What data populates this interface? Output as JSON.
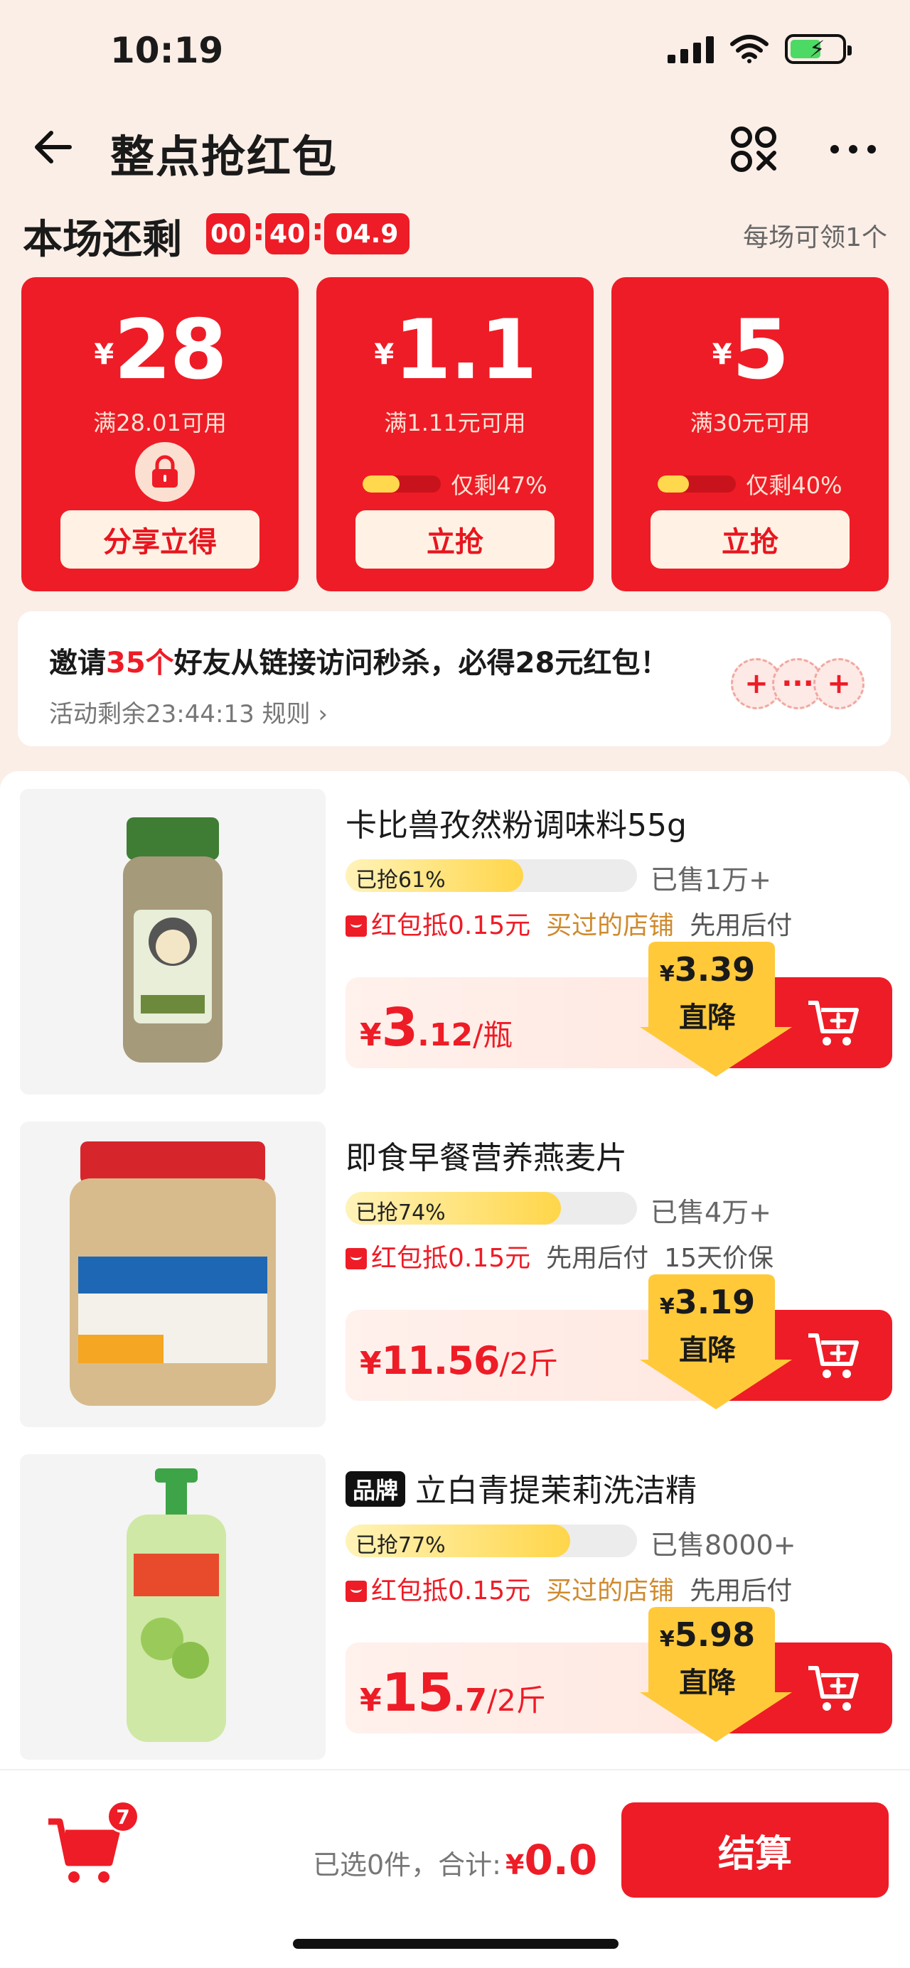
{
  "status_bar": {
    "time": "10:19"
  },
  "nav": {
    "title": "整点抢红包"
  },
  "session": {
    "label": "本场还剩",
    "hours": "00",
    "minutes": "40",
    "seconds": "04.9",
    "sep": ":",
    "right_text": "每场可领1个"
  },
  "coupons": [
    {
      "currency": "¥",
      "amount": "28",
      "condition": "满28.01可用",
      "locked": true,
      "button": "分享立得"
    },
    {
      "currency": "¥",
      "amount": "1.1",
      "condition": "满1.11元可用",
      "progress_text": "仅剩47%",
      "remaining_pct": 47,
      "button": "立抢"
    },
    {
      "currency": "¥",
      "amount": "5",
      "condition": "满30元可用",
      "progress_text": "仅剩40%",
      "remaining_pct": 40,
      "button": "立抢"
    }
  ],
  "invite": {
    "prefix": "邀请",
    "count": "35个",
    "suffix": "好友从链接访问秒杀，必得28元红包！",
    "countdown": "活动剩余23:44:13 规则 ›",
    "avatar_plus": "+",
    "avatar_more": "···"
  },
  "products": [
    {
      "name": "卡比兽孜然粉调味料55g",
      "brand": "",
      "grabbed_text": "已抢61%",
      "grabbed_pct": 61,
      "sold": "已售1万+",
      "tags": [
        "红包抵0.15元",
        "买过的店铺",
        "先用后付"
      ],
      "price_currency": "¥",
      "price_int": "3",
      "price_dec": ".12",
      "price_unit": "/瓶",
      "drop_currency": "¥",
      "drop_price": "3.39",
      "drop_label": "直降"
    },
    {
      "name": "即食早餐营养燕麦片",
      "brand": "",
      "grabbed_text": "已抢74%",
      "grabbed_pct": 74,
      "sold": "已售4万+",
      "tags": [
        "红包抵0.15元",
        "先用后付",
        "15天价保"
      ],
      "price_currency": "¥",
      "price_int": "11.56",
      "price_dec": "",
      "price_unit": "/2斤",
      "drop_currency": "¥",
      "drop_price": "3.19",
      "drop_label": "直降"
    },
    {
      "name": "立白青提茉莉洗洁精",
      "brand": "品牌",
      "grabbed_text": "已抢77%",
      "grabbed_pct": 77,
      "sold": "已售8000+",
      "tags": [
        "红包抵0.15元",
        "买过的店铺",
        "先用后付"
      ],
      "price_currency": "¥",
      "price_int": "15",
      "price_dec": ".7",
      "price_unit": "/2斤",
      "drop_currency": "¥",
      "drop_price": "5.98",
      "drop_label": "直降"
    }
  ],
  "bottom": {
    "cart_badge": "7",
    "summary": "已选0件，合计:",
    "currency": "¥",
    "total": "0.0",
    "checkout": "结算"
  },
  "colors": {
    "accent": "#ee1c26",
    "gold": "#cf8a2d",
    "background": "#fbeee6"
  }
}
